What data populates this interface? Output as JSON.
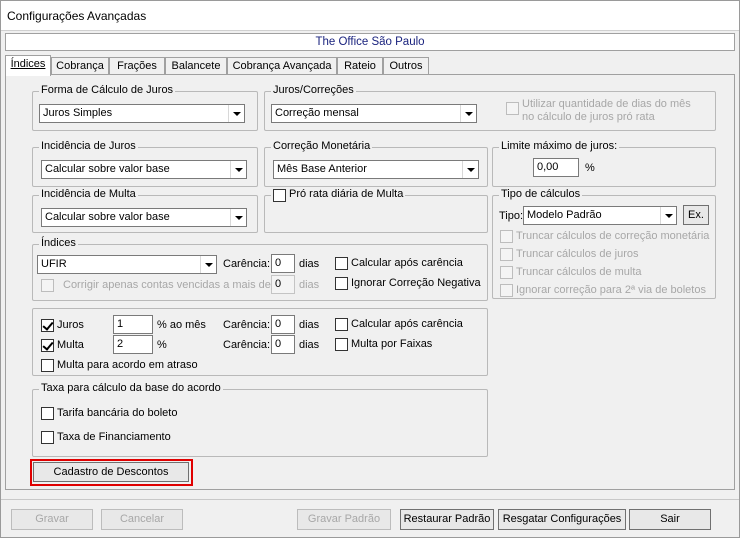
{
  "window": {
    "title": "Configurações Avançadas"
  },
  "company": "The Office São Paulo",
  "tabs": [
    "Índices",
    "Cobrança",
    "Frações",
    "Balancete",
    "Cobrança Avançada",
    "Rateio",
    "Outros"
  ],
  "forma_calculo": {
    "legend": "Forma de Cálculo de Juros",
    "value": "Juros Simples"
  },
  "juros_correcoes": {
    "legend": "Juros/Correções",
    "value": "Correção mensal"
  },
  "utilizar_dias": {
    "label_line1": "Utilizar quantidade de dias do mês",
    "label_line2": "no cálculo de juros pró rata"
  },
  "incidencia_juros": {
    "legend": "Incidência de Juros",
    "value": "Calcular sobre valor base"
  },
  "correcao_monetaria": {
    "legend": "Correção Monetária",
    "value": "Mês Base Anterior"
  },
  "limite_juros": {
    "legend": "Limite máximo de juros:",
    "value": "0,00",
    "unit": "%"
  },
  "incidencia_multa": {
    "legend": "Incidência de Multa",
    "value": "Calcular sobre valor base"
  },
  "pro_rata": {
    "legend": "Pró rata diária de Multa"
  },
  "tipo_calculos": {
    "legend": "Tipo de cálculos",
    "tipo_label": "Tipo:",
    "tipo_value": "Modelo Padrão",
    "ex_button": "Ex.",
    "options": [
      "Truncar cálculos de correção monetária",
      "Truncar cálculos de juros",
      "Truncar cálculos de multa",
      "Ignorar correção para 2ª via de boletos"
    ]
  },
  "indices": {
    "legend": "Índices",
    "value": "UFIR",
    "carencia_label": "Carência:",
    "carencia_value": "0",
    "dias": "dias",
    "calcular_apos": "Calcular após carência",
    "corrigir_label": "Corrigir apenas contas vencidas a mais de",
    "corrigir_value": "0",
    "corrigir_dias": "dias",
    "ignorar_negativa": "Ignorar Correção Negativa"
  },
  "juros_multa": {
    "juros_label": "Juros",
    "juros_value": "1",
    "juros_unit": "% ao mês",
    "juros_carencia_label": "Carência:",
    "juros_carencia_value": "0",
    "juros_dias": "dias",
    "calcular_apos": "Calcular após carência",
    "multa_label": "Multa",
    "multa_value": "2",
    "multa_unit": "%",
    "multa_carencia_label": "Carência:",
    "multa_carencia_value": "0",
    "multa_dias": "dias",
    "multa_faixas": "Multa por Faixas",
    "multa_acordo": "Multa para acordo em atraso"
  },
  "taxa_acordo": {
    "legend": "Taxa para cálculo da base do acordo",
    "tarifa": "Tarifa bancária do boleto",
    "financiamento": "Taxa de Financiamento"
  },
  "cadastro_descontos": "Cadastro de Descontos",
  "footer": {
    "gravar": "Gravar",
    "cancelar": "Cancelar",
    "gravar_padrao": "Gravar Padrão",
    "restaurar_padrao": "Restaurar Padrão",
    "resgatar": "Resgatar Configurações",
    "sair": "Sair"
  },
  "colors": {
    "highlight": "#e00000",
    "company_text": "#1a237e"
  }
}
